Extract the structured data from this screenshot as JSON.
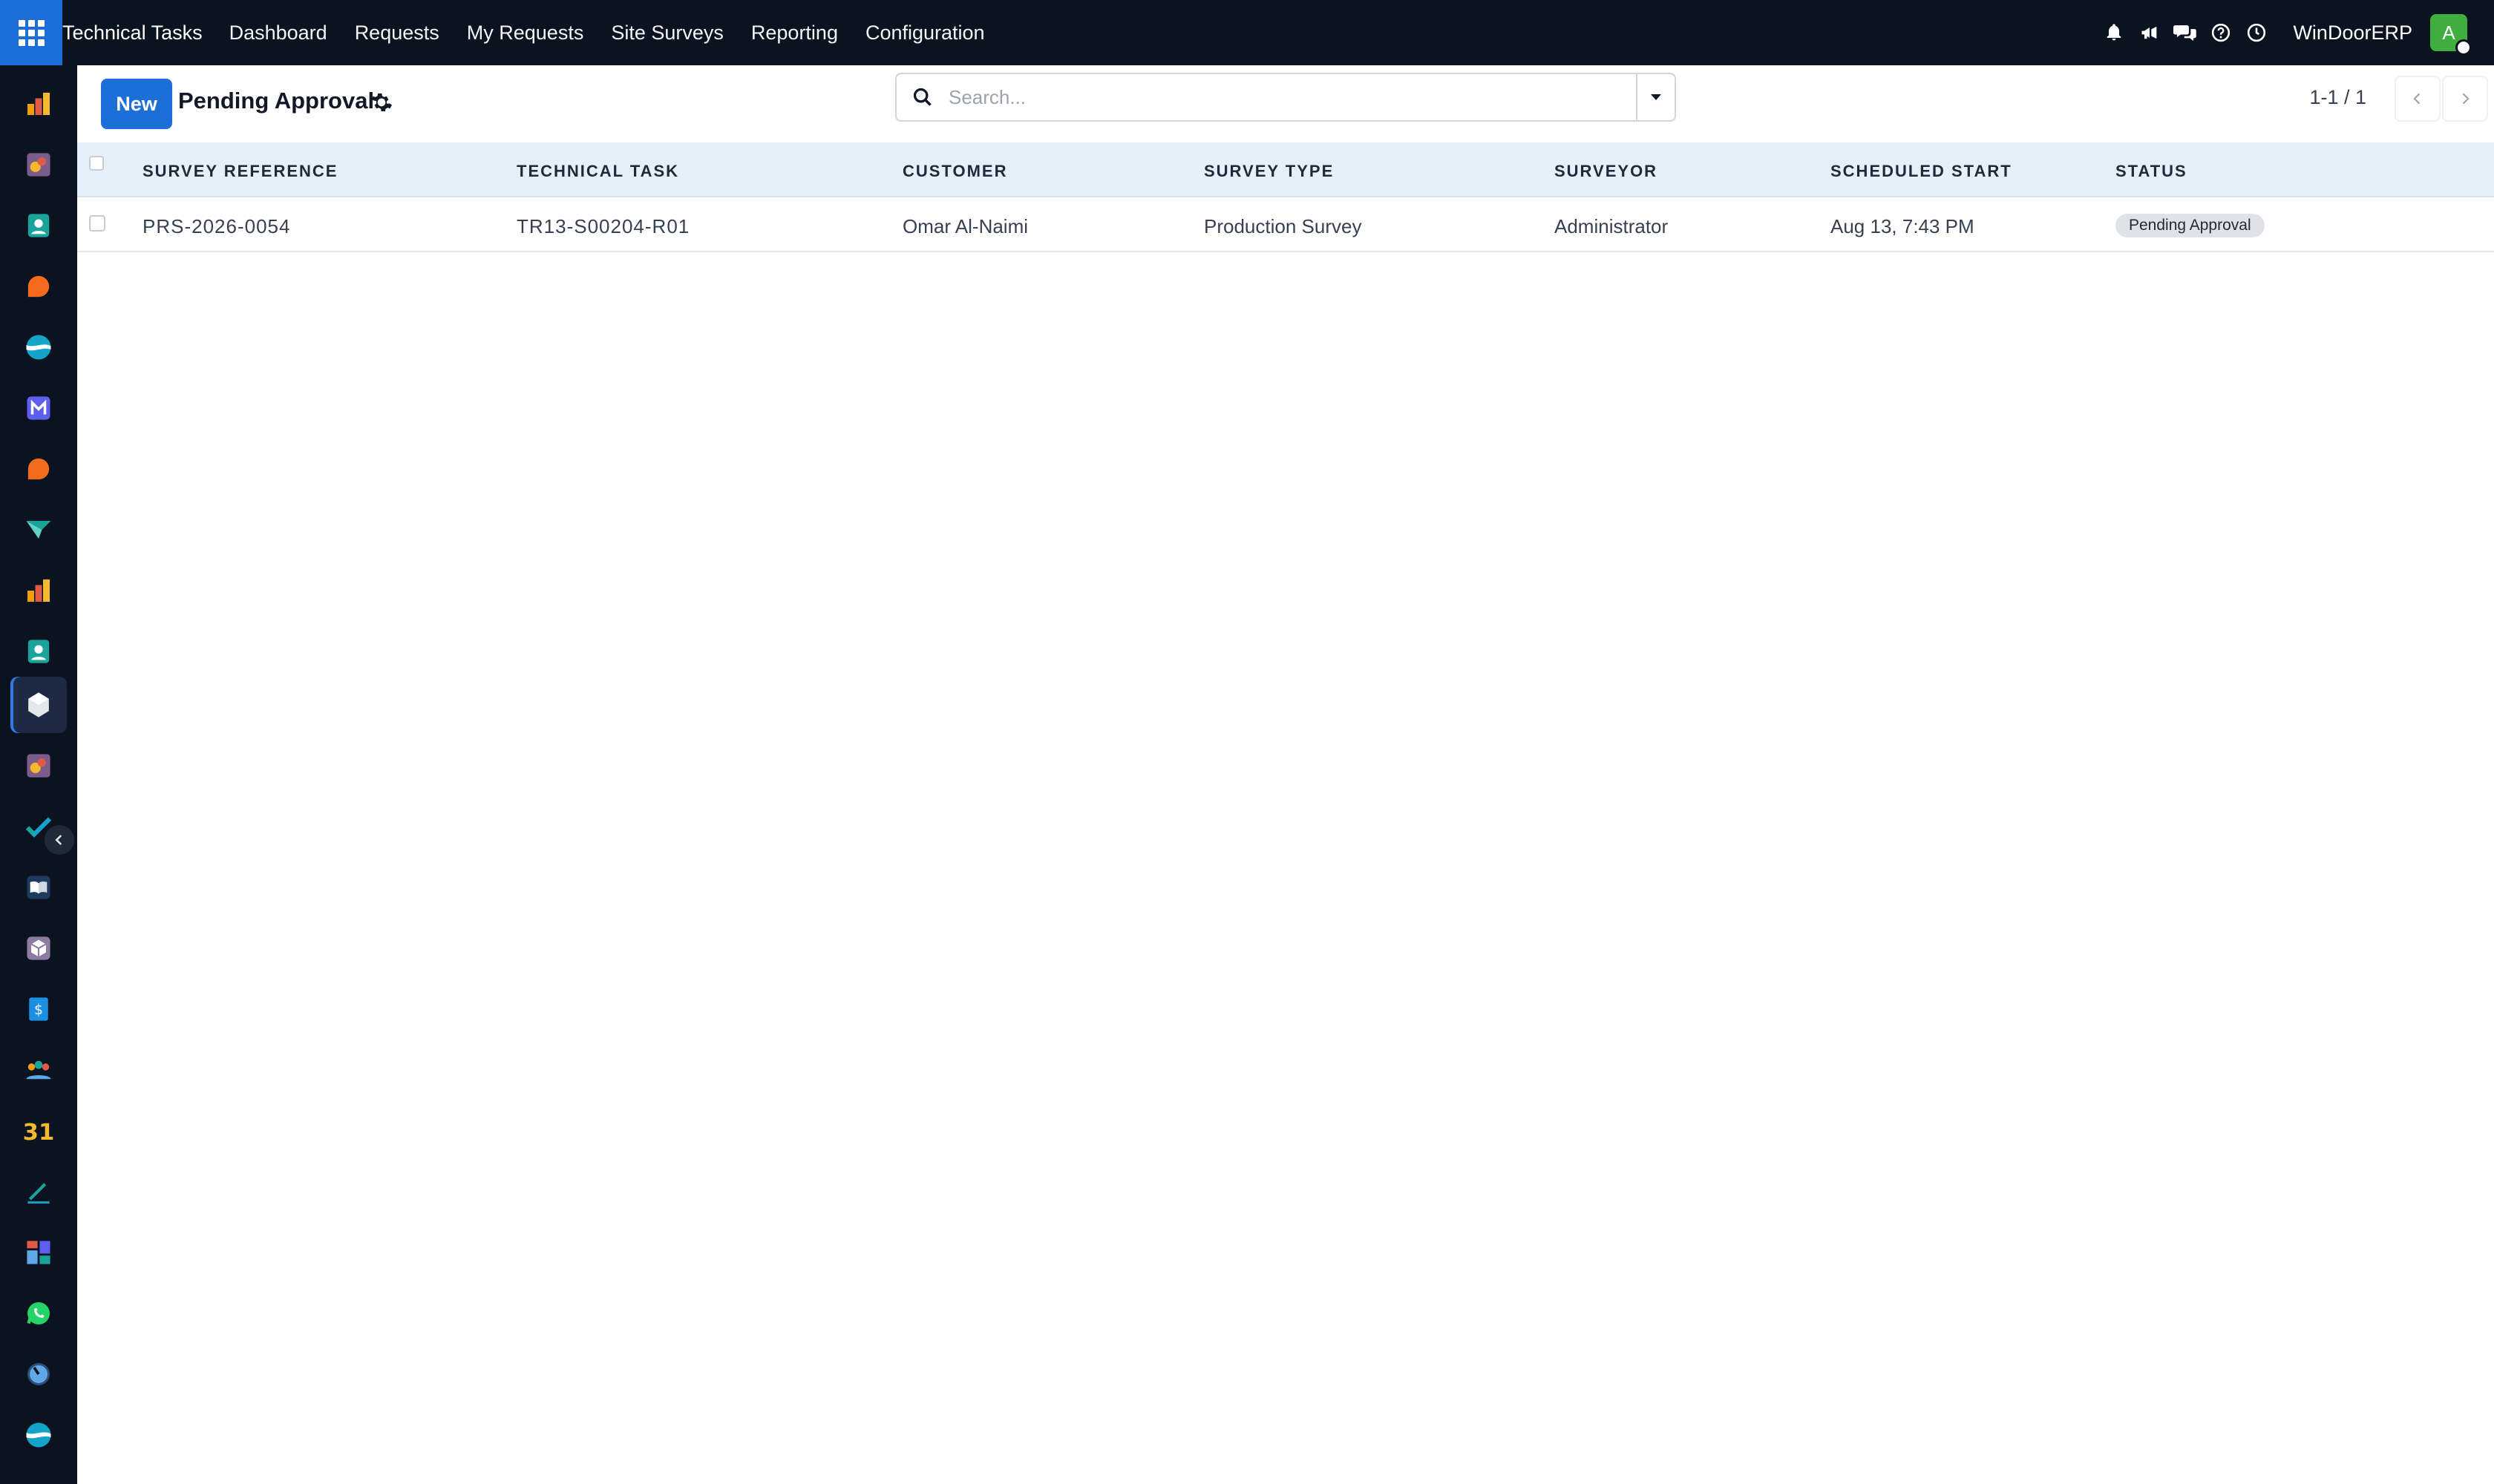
{
  "topbar": {
    "app_name": "Technical Tasks",
    "menu": [
      "Dashboard",
      "Requests",
      "My Requests",
      "Site Surveys",
      "Reporting",
      "Configuration"
    ],
    "company": "WinDoorERP",
    "avatar_initial": "A",
    "accent_color": "#1d6fd8"
  },
  "control": {
    "new_label": "New",
    "view_title": "Pending Approval",
    "search_placeholder": "Search...",
    "pager": "1-1 / 1"
  },
  "table": {
    "columns": [
      "SURVEY REFERENCE",
      "TECHNICAL TASK",
      "CUSTOMER",
      "SURVEY TYPE",
      "SURVEYOR",
      "SCHEDULED START",
      "STATUS"
    ],
    "rows": [
      {
        "survey_reference": "PRS-2026-0054",
        "technical_task": "TR13-S00204-R01",
        "customer": "Omar Al-Naimi",
        "survey_type": "Production Survey",
        "surveyor": "Administrator",
        "scheduled_start": "Aug 13, 7:43 PM",
        "status": "Pending Approval"
      }
    ]
  },
  "sidebar": {
    "items": [
      "dashboards-icon",
      "sales-icon",
      "contacts-icon",
      "discuss-icon",
      "website-icon",
      "email-marketing-icon",
      "livechat-icon",
      "studio-icon",
      "dashboards-2-icon",
      "contacts-2-icon",
      "technical-tasks-icon",
      "sales-2-icon",
      "project-icon",
      "knowledge-icon",
      "inventory-icon",
      "accounting-icon",
      "employees-icon",
      "calendar-icon",
      "sign-icon",
      "apps-dashboard-icon",
      "whatsapp-icon",
      "clock-icon",
      "website-2-icon"
    ],
    "active_index": 10
  }
}
